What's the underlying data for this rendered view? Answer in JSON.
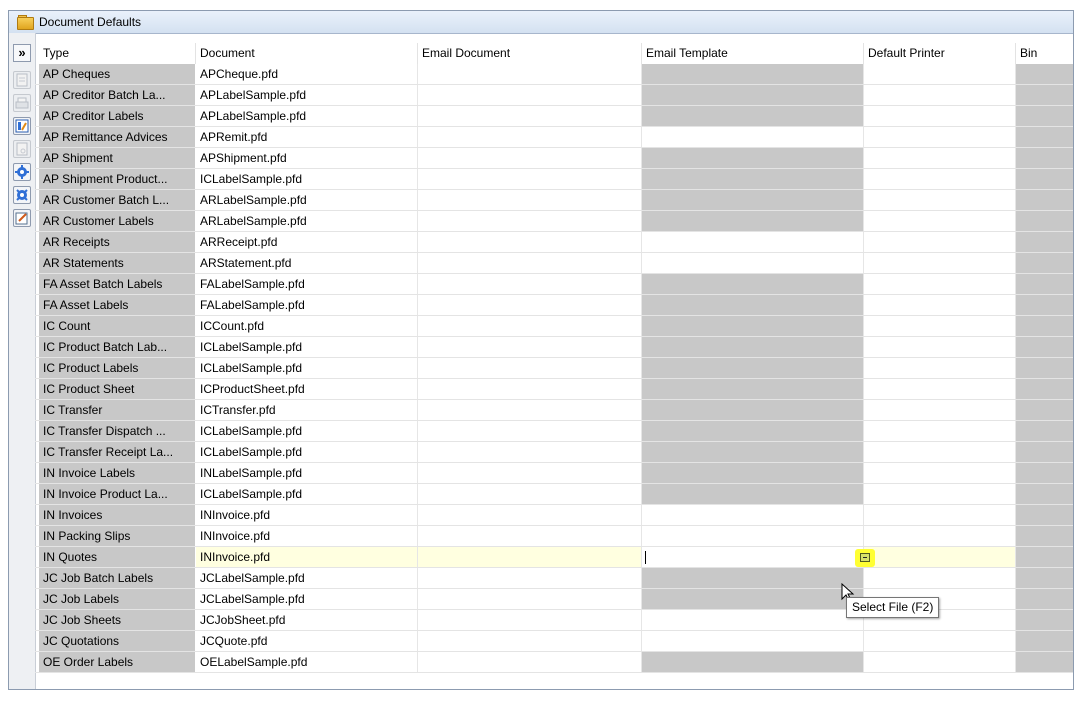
{
  "window": {
    "title": "Document Defaults"
  },
  "toolbar": {
    "expand_label": "»"
  },
  "columns": [
    "Type",
    "Document",
    "Email Document",
    "Email Template",
    "Default Printer",
    "Bin"
  ],
  "rows": [
    {
      "type": "AP Cheques",
      "document": "APCheque.pfd",
      "tpl_gray": true
    },
    {
      "type": "AP Creditor Batch La...",
      "document": "APLabelSample.pfd",
      "tpl_gray": true
    },
    {
      "type": "AP Creditor Labels",
      "document": "APLabelSample.pfd",
      "tpl_gray": true
    },
    {
      "type": "AP Remittance Advices",
      "document": "APRemit.pfd",
      "tpl_gray": false
    },
    {
      "type": "AP Shipment",
      "document": "APShipment.pfd",
      "tpl_gray": true
    },
    {
      "type": "AP Shipment Product...",
      "document": "ICLabelSample.pfd",
      "tpl_gray": true
    },
    {
      "type": "AR Customer Batch L...",
      "document": "ARLabelSample.pfd",
      "tpl_gray": true
    },
    {
      "type": "AR Customer Labels",
      "document": "ARLabelSample.pfd",
      "tpl_gray": true
    },
    {
      "type": "AR Receipts",
      "document": "ARReceipt.pfd",
      "tpl_gray": false
    },
    {
      "type": "AR Statements",
      "document": "ARStatement.pfd",
      "tpl_gray": false
    },
    {
      "type": "FA Asset Batch Labels",
      "document": "FALabelSample.pfd",
      "tpl_gray": true
    },
    {
      "type": "FA Asset Labels",
      "document": "FALabelSample.pfd",
      "tpl_gray": true
    },
    {
      "type": "IC Count",
      "document": "ICCount.pfd",
      "tpl_gray": true
    },
    {
      "type": "IC Product Batch Lab...",
      "document": "ICLabelSample.pfd",
      "tpl_gray": true
    },
    {
      "type": "IC Product Labels",
      "document": "ICLabelSample.pfd",
      "tpl_gray": true
    },
    {
      "type": "IC Product Sheet",
      "document": "ICProductSheet.pfd",
      "tpl_gray": true
    },
    {
      "type": "IC Transfer",
      "document": "ICTransfer.pfd",
      "tpl_gray": true
    },
    {
      "type": "IC Transfer Dispatch ...",
      "document": "ICLabelSample.pfd",
      "tpl_gray": true
    },
    {
      "type": "IC Transfer Receipt La...",
      "document": "ICLabelSample.pfd",
      "tpl_gray": true
    },
    {
      "type": "IN Invoice Labels",
      "document": "INLabelSample.pfd",
      "tpl_gray": true
    },
    {
      "type": "IN Invoice Product La...",
      "document": "ICLabelSample.pfd",
      "tpl_gray": true
    },
    {
      "type": "IN Invoices",
      "document": "INInvoice.pfd",
      "tpl_gray": false
    },
    {
      "type": "IN Packing Slips",
      "document": "INInvoice.pfd",
      "tpl_gray": false
    },
    {
      "type": "IN Quotes",
      "document": "INInvoice.pfd",
      "tpl_gray": false,
      "selected": true
    },
    {
      "type": "JC Job Batch Labels",
      "document": "JCLabelSample.pfd",
      "tpl_gray": true
    },
    {
      "type": "JC Job Labels",
      "document": "JCLabelSample.pfd",
      "tpl_gray": true
    },
    {
      "type": "JC Job Sheets",
      "document": "JCJobSheet.pfd",
      "tpl_gray": false
    },
    {
      "type": "JC Quotations",
      "document": "JCQuote.pfd",
      "tpl_gray": false
    },
    {
      "type": "OE Order Labels",
      "document": "OELabelSample.pfd",
      "tpl_gray": true
    }
  ],
  "tooltip": {
    "text": "Select File (F2)"
  }
}
